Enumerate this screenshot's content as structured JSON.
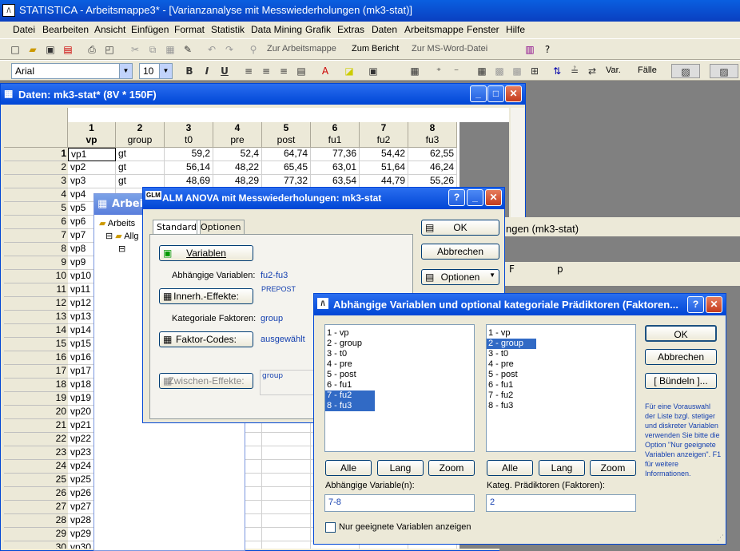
{
  "app": {
    "title": "STATISTICA - Arbeitsmappe3* - [Varianzanalyse mit Messwiederholungen (mk3-stat)]"
  },
  "menu": [
    "Datei",
    "Bearbeiten",
    "Ansicht",
    "Einfügen",
    "Format",
    "Statistik",
    "Data Mining",
    "Grafik",
    "Extras",
    "Daten",
    "Arbeitsmappe",
    "Fenster",
    "Hilfe"
  ],
  "toolbar": {
    "to_workbook": "Zur Arbeitsmappe",
    "to_report": "Zum Bericht",
    "to_word": "Zur MS-Word-Datei",
    "font": "Arial",
    "size": "10",
    "bold": "B",
    "italic": "I",
    "underline": "U",
    "var_label": "Var.",
    "cases_label": "Fälle"
  },
  "datawin": {
    "title": "Daten: mk3-stat* (8V * 150F)"
  },
  "columns": [
    {
      "num": "1",
      "name": "vp"
    },
    {
      "num": "2",
      "name": "group"
    },
    {
      "num": "3",
      "name": "t0"
    },
    {
      "num": "4",
      "name": "pre"
    },
    {
      "num": "5",
      "name": "post"
    },
    {
      "num": "6",
      "name": "fu1"
    },
    {
      "num": "7",
      "name": "fu2"
    },
    {
      "num": "8",
      "name": "fu3"
    }
  ],
  "rows": [
    [
      "1",
      "vp1",
      "gt",
      "59,2",
      "52,4",
      "64,74",
      "77,36",
      "54,42",
      "62,55"
    ],
    [
      "2",
      "vp2",
      "gt",
      "56,14",
      "48,22",
      "65,45",
      "63,01",
      "51,64",
      "46,24"
    ],
    [
      "3",
      "vp3",
      "gt",
      "48,69",
      "48,29",
      "77,32",
      "63,54",
      "44,79",
      "55,26"
    ],
    [
      "4",
      "vp4",
      "",
      "",
      "",
      "",
      "",
      "",
      ""
    ],
    [
      "5",
      "vp5",
      "",
      "",
      "",
      "",
      "",
      "",
      ""
    ],
    [
      "6",
      "vp6",
      "",
      "",
      "",
      "",
      "",
      "",
      ""
    ],
    [
      "7",
      "vp7",
      "",
      "",
      "",
      "",
      "",
      "",
      ""
    ],
    [
      "8",
      "vp8",
      "",
      "",
      "",
      "",
      "",
      "",
      ""
    ],
    [
      "9",
      "vp9",
      "",
      "",
      "",
      "",
      "",
      "",
      ""
    ],
    [
      "10",
      "vp10",
      "",
      "",
      "",
      "",
      "",
      "",
      ""
    ],
    [
      "11",
      "vp11",
      "",
      "",
      "",
      "",
      "",
      "",
      ""
    ],
    [
      "12",
      "vp12",
      "",
      "",
      "",
      "",
      "",
      "",
      ""
    ],
    [
      "13",
      "vp13",
      "",
      "",
      "",
      "",
      "",
      "",
      ""
    ],
    [
      "14",
      "vp14",
      "",
      "",
      "",
      "",
      "",
      "",
      ""
    ],
    [
      "15",
      "vp15",
      "",
      "",
      "",
      "",
      "",
      "",
      ""
    ],
    [
      "16",
      "vp16",
      "",
      "",
      "",
      "",
      "",
      "",
      ""
    ],
    [
      "17",
      "vp17",
      "",
      "",
      "",
      "",
      "",
      "",
      ""
    ],
    [
      "18",
      "vp18",
      "",
      "",
      "",
      "",
      "",
      "",
      ""
    ],
    [
      "19",
      "vp19",
      "",
      "",
      "",
      "",
      "",
      "",
      ""
    ],
    [
      "20",
      "vp20",
      "",
      "",
      "",
      "",
      "",
      "",
      ""
    ],
    [
      "21",
      "vp21",
      "",
      "",
      "",
      "",
      "",
      "",
      ""
    ],
    [
      "22",
      "vp22",
      "",
      "",
      "",
      "",
      "",
      "",
      ""
    ],
    [
      "23",
      "vp23",
      "",
      "",
      "",
      "",
      "",
      "",
      ""
    ],
    [
      "24",
      "vp24",
      "",
      "",
      "",
      "",
      "",
      "",
      ""
    ],
    [
      "25",
      "vp25",
      "",
      "",
      "",
      "",
      "",
      "",
      ""
    ],
    [
      "26",
      "vp26",
      "",
      "",
      "",
      "",
      "",
      "",
      ""
    ],
    [
      "27",
      "vp27",
      "",
      "",
      "",
      "",
      "",
      "",
      ""
    ],
    [
      "28",
      "vp28",
      "",
      "",
      "",
      "",
      "",
      "",
      ""
    ],
    [
      "29",
      "vp29",
      "",
      "",
      "",
      "",
      "",
      "",
      ""
    ],
    [
      "30",
      "vp30",
      "",
      "",
      "",
      "",
      "",
      "",
      ""
    ]
  ],
  "arbwin": {
    "title": "Arbeit",
    "item1": "Arbeits",
    "item2": "Allg"
  },
  "result": {
    "title_frag": "ngen (mk3-stat)",
    "col_f": "F",
    "col_p": "p"
  },
  "glm": {
    "title": "ALM ANOVA mit Messwiederholungen: mk3-stat",
    "tab_standard": "Standard",
    "tab_options": "Optionen",
    "variables_btn": "Variablen",
    "dep_label": "Abhängige Variablen:",
    "dep_value": "fu2-fu3",
    "prepost": "PREPOST",
    "within_btn": "Innerh.-Effekte:",
    "cat_label": "Kategoriale Faktoren:",
    "cat_value": "group",
    "codes_btn": "Faktor-Codes:",
    "codes_value": "ausgewählt",
    "between_btn": "Zwischen-Effekte:",
    "between_value": "group",
    "ok": "OK",
    "cancel": "Abbrechen",
    "options": "Optionen"
  },
  "dlg": {
    "title": "Abhängige Variablen und optional kategoriale Prädiktoren (Faktoren...",
    "left_items": [
      "1 - vp",
      "2 - group",
      "3 - t0",
      "4 - pre",
      "5 - post",
      "6 - fu1",
      "7 - fu2",
      "8 - fu3"
    ],
    "right_items": [
      "1 - vp",
      "2 - group",
      "3 - t0",
      "4 - pre",
      "5 - post",
      "6 - fu1",
      "7 - fu2",
      "8 - fu3"
    ],
    "all": "Alle",
    "long": "Lang",
    "zoom": "Zoom",
    "dep_label": "Abhängige Variable(n):",
    "dep_value": "7-8",
    "pred_label": "Kateg. Prädiktoren (Faktoren):",
    "pred_value": "2",
    "checkbox": "Nur geeignete Variablen anzeigen",
    "ok": "OK",
    "cancel": "Abbrechen",
    "bundle": "[ Bündeln ]...",
    "info": "Für eine Vorauswahl der Liste bzgl. stetiger und diskreter Variablen verwenden Sie bitte die Option \"Nur geeignete Variablen anzeigen\". F1 für weitere Informationen."
  }
}
